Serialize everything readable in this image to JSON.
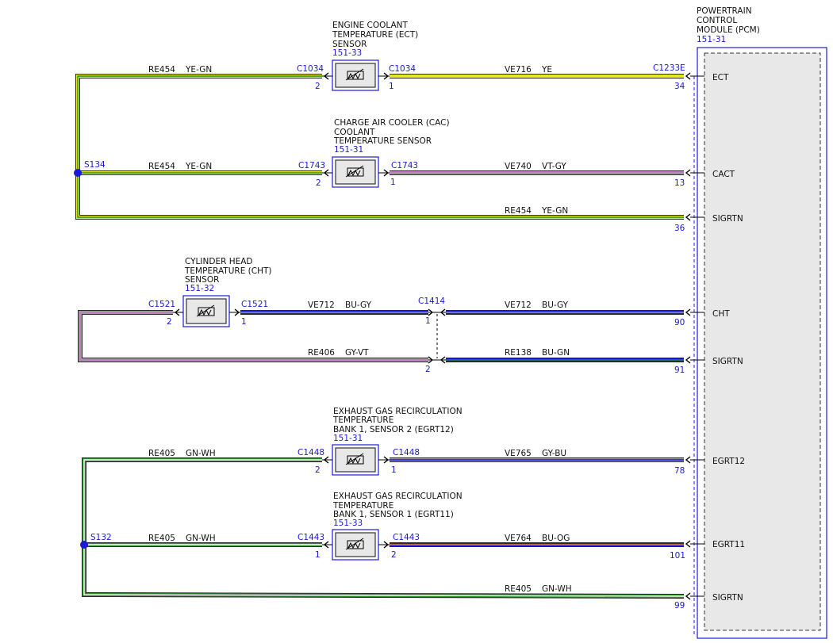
{
  "colors": {
    "YE": "#e8e820",
    "GN": "#2a8a2a",
    "BU": "#1414d8",
    "GY": "#9a9a9a",
    "VT": "#c77ac7",
    "OG": "#e08a1a",
    "WH": "#ffffff",
    "label_blue": "#1a1ad6",
    "pcm_fill": "#e8e8e8"
  },
  "pcm": {
    "title_lines": [
      "POWERTRAIN",
      "CONTROL",
      "MODULE (PCM)"
    ],
    "ref": "151-31",
    "pins": [
      "ECT",
      "CACT",
      "SIGRTN",
      "CHT",
      "SIGRTN",
      "EGRT12",
      "EGRT11",
      "SIGRTN"
    ]
  },
  "components": [
    {
      "id": "ect",
      "title_lines": [
        "ENGINE COOLANT",
        "TEMPERATURE (ECT)",
        "SENSOR"
      ],
      "ref": "151-33",
      "left_conn": "C1034",
      "left_pin": "2",
      "right_conn": "C1034",
      "right_pin": "1"
    },
    {
      "id": "cac",
      "title_lines": [
        "CHARGE AIR COOLER (CAC)",
        "COOLANT",
        "TEMPERATURE SENSOR"
      ],
      "ref": "151-31",
      "left_conn": "C1743",
      "left_pin": "2",
      "right_conn": "C1743",
      "right_pin": "1"
    },
    {
      "id": "cht",
      "title_lines": [
        "CYLINDER HEAD",
        "TEMPERATURE (CHT)",
        "SENSOR"
      ],
      "ref": "151-32",
      "left_conn": "C1521",
      "left_pin": "2",
      "right_conn": "C1521",
      "right_pin": "1"
    },
    {
      "id": "egrt12",
      "title_lines": [
        "EXHAUST GAS RECIRCULATION",
        "TEMPERATURE",
        "BANK 1, SENSOR 2 (EGRT12)"
      ],
      "ref": "151-31",
      "left_conn": "C1448",
      "left_pin": "2",
      "right_conn": "C1448",
      "right_pin": "1"
    },
    {
      "id": "egrt11",
      "title_lines": [
        "EXHAUST GAS RECIRCULATION",
        "TEMPERATURE",
        "BANK 1, SENSOR 1 (EGRT11)"
      ],
      "ref": "151-33",
      "left_conn": "C1443",
      "left_pin": "1",
      "right_conn": "C1443",
      "right_pin": "2"
    }
  ],
  "splices": [
    {
      "id": "S134"
    },
    {
      "id": "S132"
    }
  ],
  "inline_connector": {
    "id": "C1414",
    "pins": [
      "1",
      "2"
    ]
  },
  "pcm_connector": "C1233E",
  "wires": [
    {
      "circuit": "RE454",
      "color": "YE-GN"
    },
    {
      "circuit": "VE716",
      "color": "YE",
      "pcm_pin": "34"
    },
    {
      "circuit": "RE454",
      "color": "YE-GN"
    },
    {
      "circuit": "VE740",
      "color": "VT-GY",
      "pcm_pin": "13"
    },
    {
      "circuit": "RE454",
      "color": "YE-GN",
      "pcm_pin": "36"
    },
    {
      "circuit": "VE712",
      "color": "BU-GY"
    },
    {
      "circuit": "VE712",
      "color": "BU-GY",
      "pcm_pin": "90"
    },
    {
      "circuit": "RE406",
      "color": "GY-VT"
    },
    {
      "circuit": "RE138",
      "color": "BU-GN",
      "pcm_pin": "91"
    },
    {
      "circuit": "RE405",
      "color": "GN-WH"
    },
    {
      "circuit": "VE765",
      "color": "GY-BU",
      "pcm_pin": "78"
    },
    {
      "circuit": "RE405",
      "color": "GN-WH"
    },
    {
      "circuit": "VE764",
      "color": "BU-OG",
      "pcm_pin": "101"
    },
    {
      "circuit": "RE405",
      "color": "GN-WH",
      "pcm_pin": "99"
    }
  ]
}
